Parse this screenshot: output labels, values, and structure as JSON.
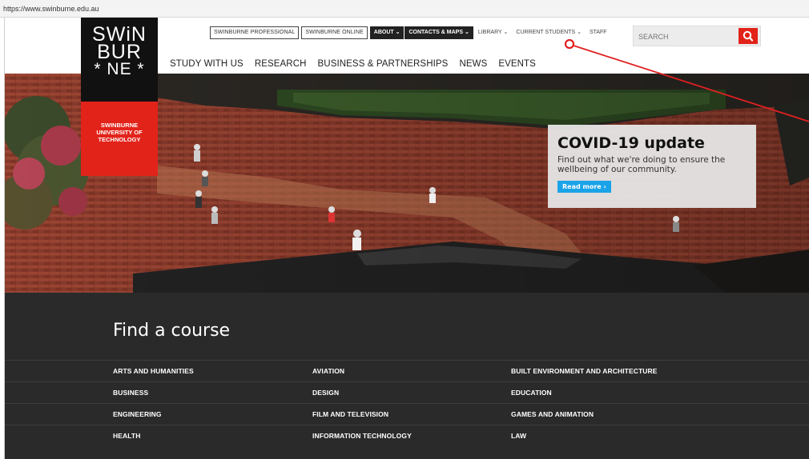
{
  "browser": {
    "url": "https://www.swinburne.edu.au"
  },
  "logo": {
    "lines": [
      "SWiN",
      "BUR",
      "* NE *"
    ],
    "sub": [
      "SWINBURNE",
      "UNIVERSITY OF",
      "TECHNOLOGY"
    ]
  },
  "topnav": {
    "boxed": [
      "SWINBURNE PROFESSIONAL",
      "SWINBURNE ONLINE"
    ],
    "dark": [
      "ABOUT ⌄",
      "CONTACTS & MAPS ⌄"
    ],
    "plain": [
      "LIBRARY ⌄",
      "CURRENT STUDENTS ⌄",
      "STAFF"
    ]
  },
  "search": {
    "placeholder": "SEARCH"
  },
  "mainnav": [
    "STUDY WITH US",
    "RESEARCH",
    "BUSINESS & PARTNERSHIPS",
    "NEWS",
    "EVENTS"
  ],
  "covid": {
    "title": "COVID-19 update",
    "text": "Find out what we're doing to ensure the wellbeing of our community.",
    "button": "Read more ›"
  },
  "course": {
    "title": "Find a course",
    "rows": [
      [
        "ARTS AND HUMANITIES",
        "AVIATION",
        "BUILT ENVIRONMENT AND ARCHITECTURE"
      ],
      [
        "BUSINESS",
        "DESIGN",
        "EDUCATION"
      ],
      [
        "ENGINEERING",
        "FILM AND TELEVISION",
        "GAMES AND ANIMATION"
      ],
      [
        "HEALTH",
        "INFORMATION TECHNOLOGY",
        "LAW"
      ]
    ]
  },
  "colors": {
    "brand_red": "#e2231a",
    "button_blue": "#1aa3e8",
    "annotation": "#e02020"
  }
}
